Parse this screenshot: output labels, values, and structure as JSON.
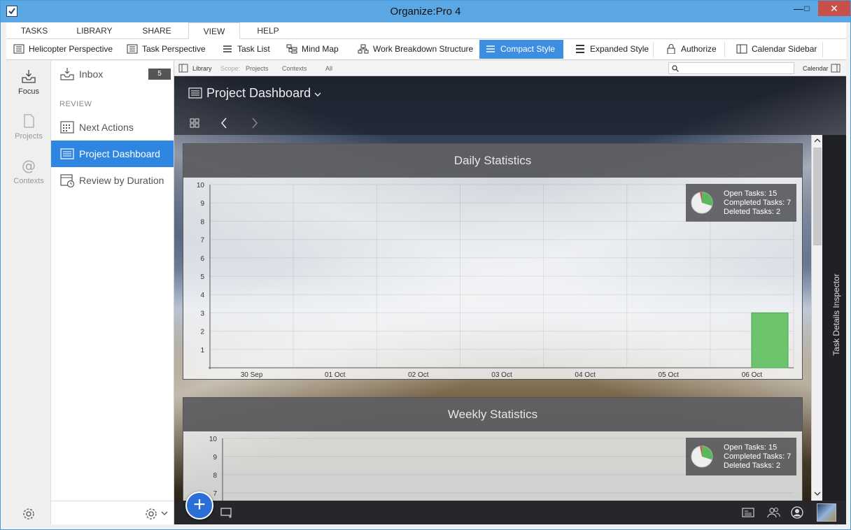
{
  "window": {
    "title": "Organize:Pro 4"
  },
  "menu": {
    "tabs": [
      "TASKS",
      "LIBRARY",
      "SHARE",
      "VIEW",
      "HELP"
    ],
    "active": "VIEW"
  },
  "toolbar": {
    "items": [
      "Helicopter Perspective",
      "Task Perspective",
      "Task List",
      "Mind Map",
      "Work Breakdown Structure",
      "Compact Style",
      "Expanded Style",
      "Authorize",
      "Calendar Sidebar"
    ],
    "active": "Compact Style"
  },
  "rail": {
    "items": [
      "Focus",
      "Projects",
      "Contexts"
    ],
    "active": "Focus"
  },
  "sidebar": {
    "inbox": {
      "label": "Inbox",
      "count": "5"
    },
    "section": "REVIEW",
    "items": [
      "Next Actions",
      "Project Dashboard",
      "Review by Duration"
    ],
    "selected": "Project Dashboard"
  },
  "scopebar": {
    "library": "Library",
    "scope_label": "Scope:",
    "scopes": [
      "Projects",
      "Contexts",
      "All"
    ],
    "calendar": "Calendar"
  },
  "dashboard": {
    "title": "Project Dashboard"
  },
  "inspector": {
    "label": "Task Details Inspector"
  },
  "colors": {
    "accent": "#2f86e0",
    "bar": "#6cc46c",
    "pie_open": "#eeeeee",
    "pie_completed": "#5cb85c",
    "pie_deleted": "#d9534f"
  },
  "panels": [
    {
      "title": "Daily Statistics",
      "stats": [
        "Open Tasks: 15",
        "Completed Tasks: 7",
        "Deleted Tasks: 2"
      ]
    },
    {
      "title": "Weekly Statistics",
      "stats": [
        "Open Tasks: 15",
        "Completed Tasks: 7",
        "Deleted Tasks: 2"
      ]
    }
  ],
  "chart_data": [
    {
      "type": "bar",
      "categories": [
        "30 Sep",
        "01 Oct",
        "02 Oct",
        "03 Oct",
        "04 Oct",
        "05 Oct",
        "06 Oct"
      ],
      "values": [
        0,
        0,
        0,
        0,
        0,
        0,
        3
      ],
      "ylim": [
        0,
        10
      ],
      "yticks": [
        1,
        2,
        3,
        4,
        5,
        6,
        7,
        8,
        9,
        10
      ],
      "grid": true
    },
    {
      "type": "bar",
      "yticks_visible": [
        10,
        9,
        8,
        7
      ],
      "ylim": [
        0,
        10
      ],
      "grid": true
    }
  ]
}
